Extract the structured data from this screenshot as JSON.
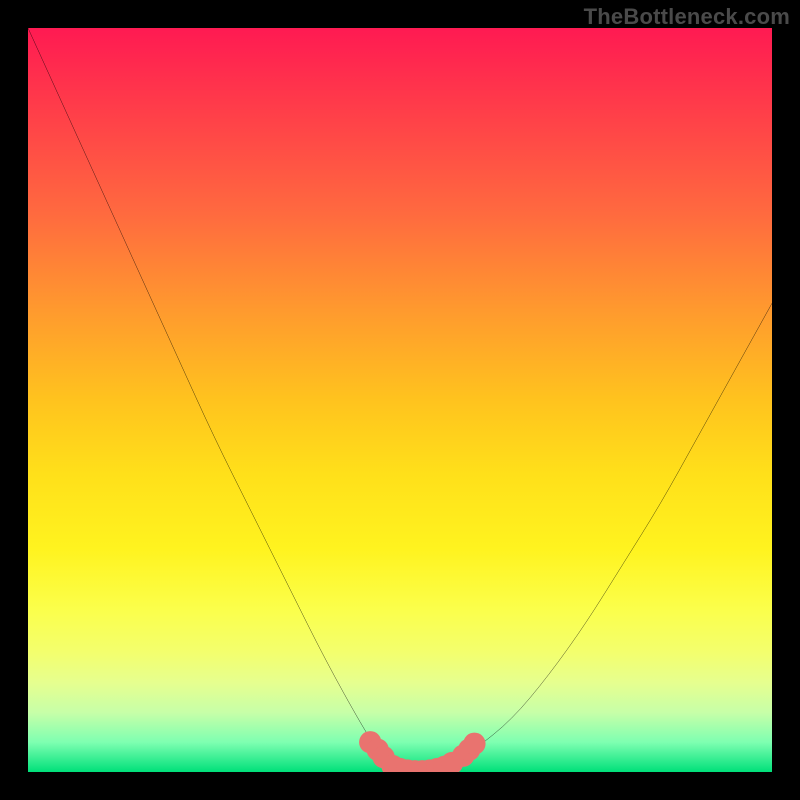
{
  "watermark": "TheBottleneck.com",
  "chart_data": {
    "type": "line",
    "title": "",
    "xlabel": "",
    "ylabel": "",
    "xlim": [
      0,
      100
    ],
    "ylim": [
      0,
      100
    ],
    "x": [
      0,
      5,
      10,
      15,
      20,
      25,
      30,
      35,
      40,
      45,
      47,
      49,
      51,
      53,
      55,
      57,
      60,
      65,
      70,
      75,
      80,
      85,
      90,
      95,
      100
    ],
    "values": [
      100,
      89,
      78,
      67,
      56,
      45,
      35,
      25,
      15,
      6,
      3,
      1,
      0,
      0,
      0,
      1,
      3,
      7,
      13,
      20,
      28,
      36,
      45,
      54,
      63
    ],
    "gradient_stops": [
      {
        "pct": 0,
        "color": "#ff1a52"
      },
      {
        "pct": 25,
        "color": "#ff6a3f"
      },
      {
        "pct": 50,
        "color": "#ffc31e"
      },
      {
        "pct": 75,
        "color": "#fbff4a"
      },
      {
        "pct": 100,
        "color": "#00e07a"
      }
    ],
    "markers": {
      "color": "#e9736f",
      "radius_pct": 1.5,
      "points": [
        {
          "x": 46,
          "y": 4
        },
        {
          "x": 47,
          "y": 3
        },
        {
          "x": 47.8,
          "y": 2
        },
        {
          "x": 49,
          "y": 0.8
        },
        {
          "x": 50,
          "y": 0.4
        },
        {
          "x": 51,
          "y": 0.2
        },
        {
          "x": 52,
          "y": 0.1
        },
        {
          "x": 53,
          "y": 0.1
        },
        {
          "x": 54,
          "y": 0.2
        },
        {
          "x": 55,
          "y": 0.4
        },
        {
          "x": 56,
          "y": 0.7
        },
        {
          "x": 57,
          "y": 1.2
        },
        {
          "x": 58.5,
          "y": 2.2
        },
        {
          "x": 59.3,
          "y": 3
        },
        {
          "x": 60,
          "y": 3.8
        }
      ]
    }
  }
}
